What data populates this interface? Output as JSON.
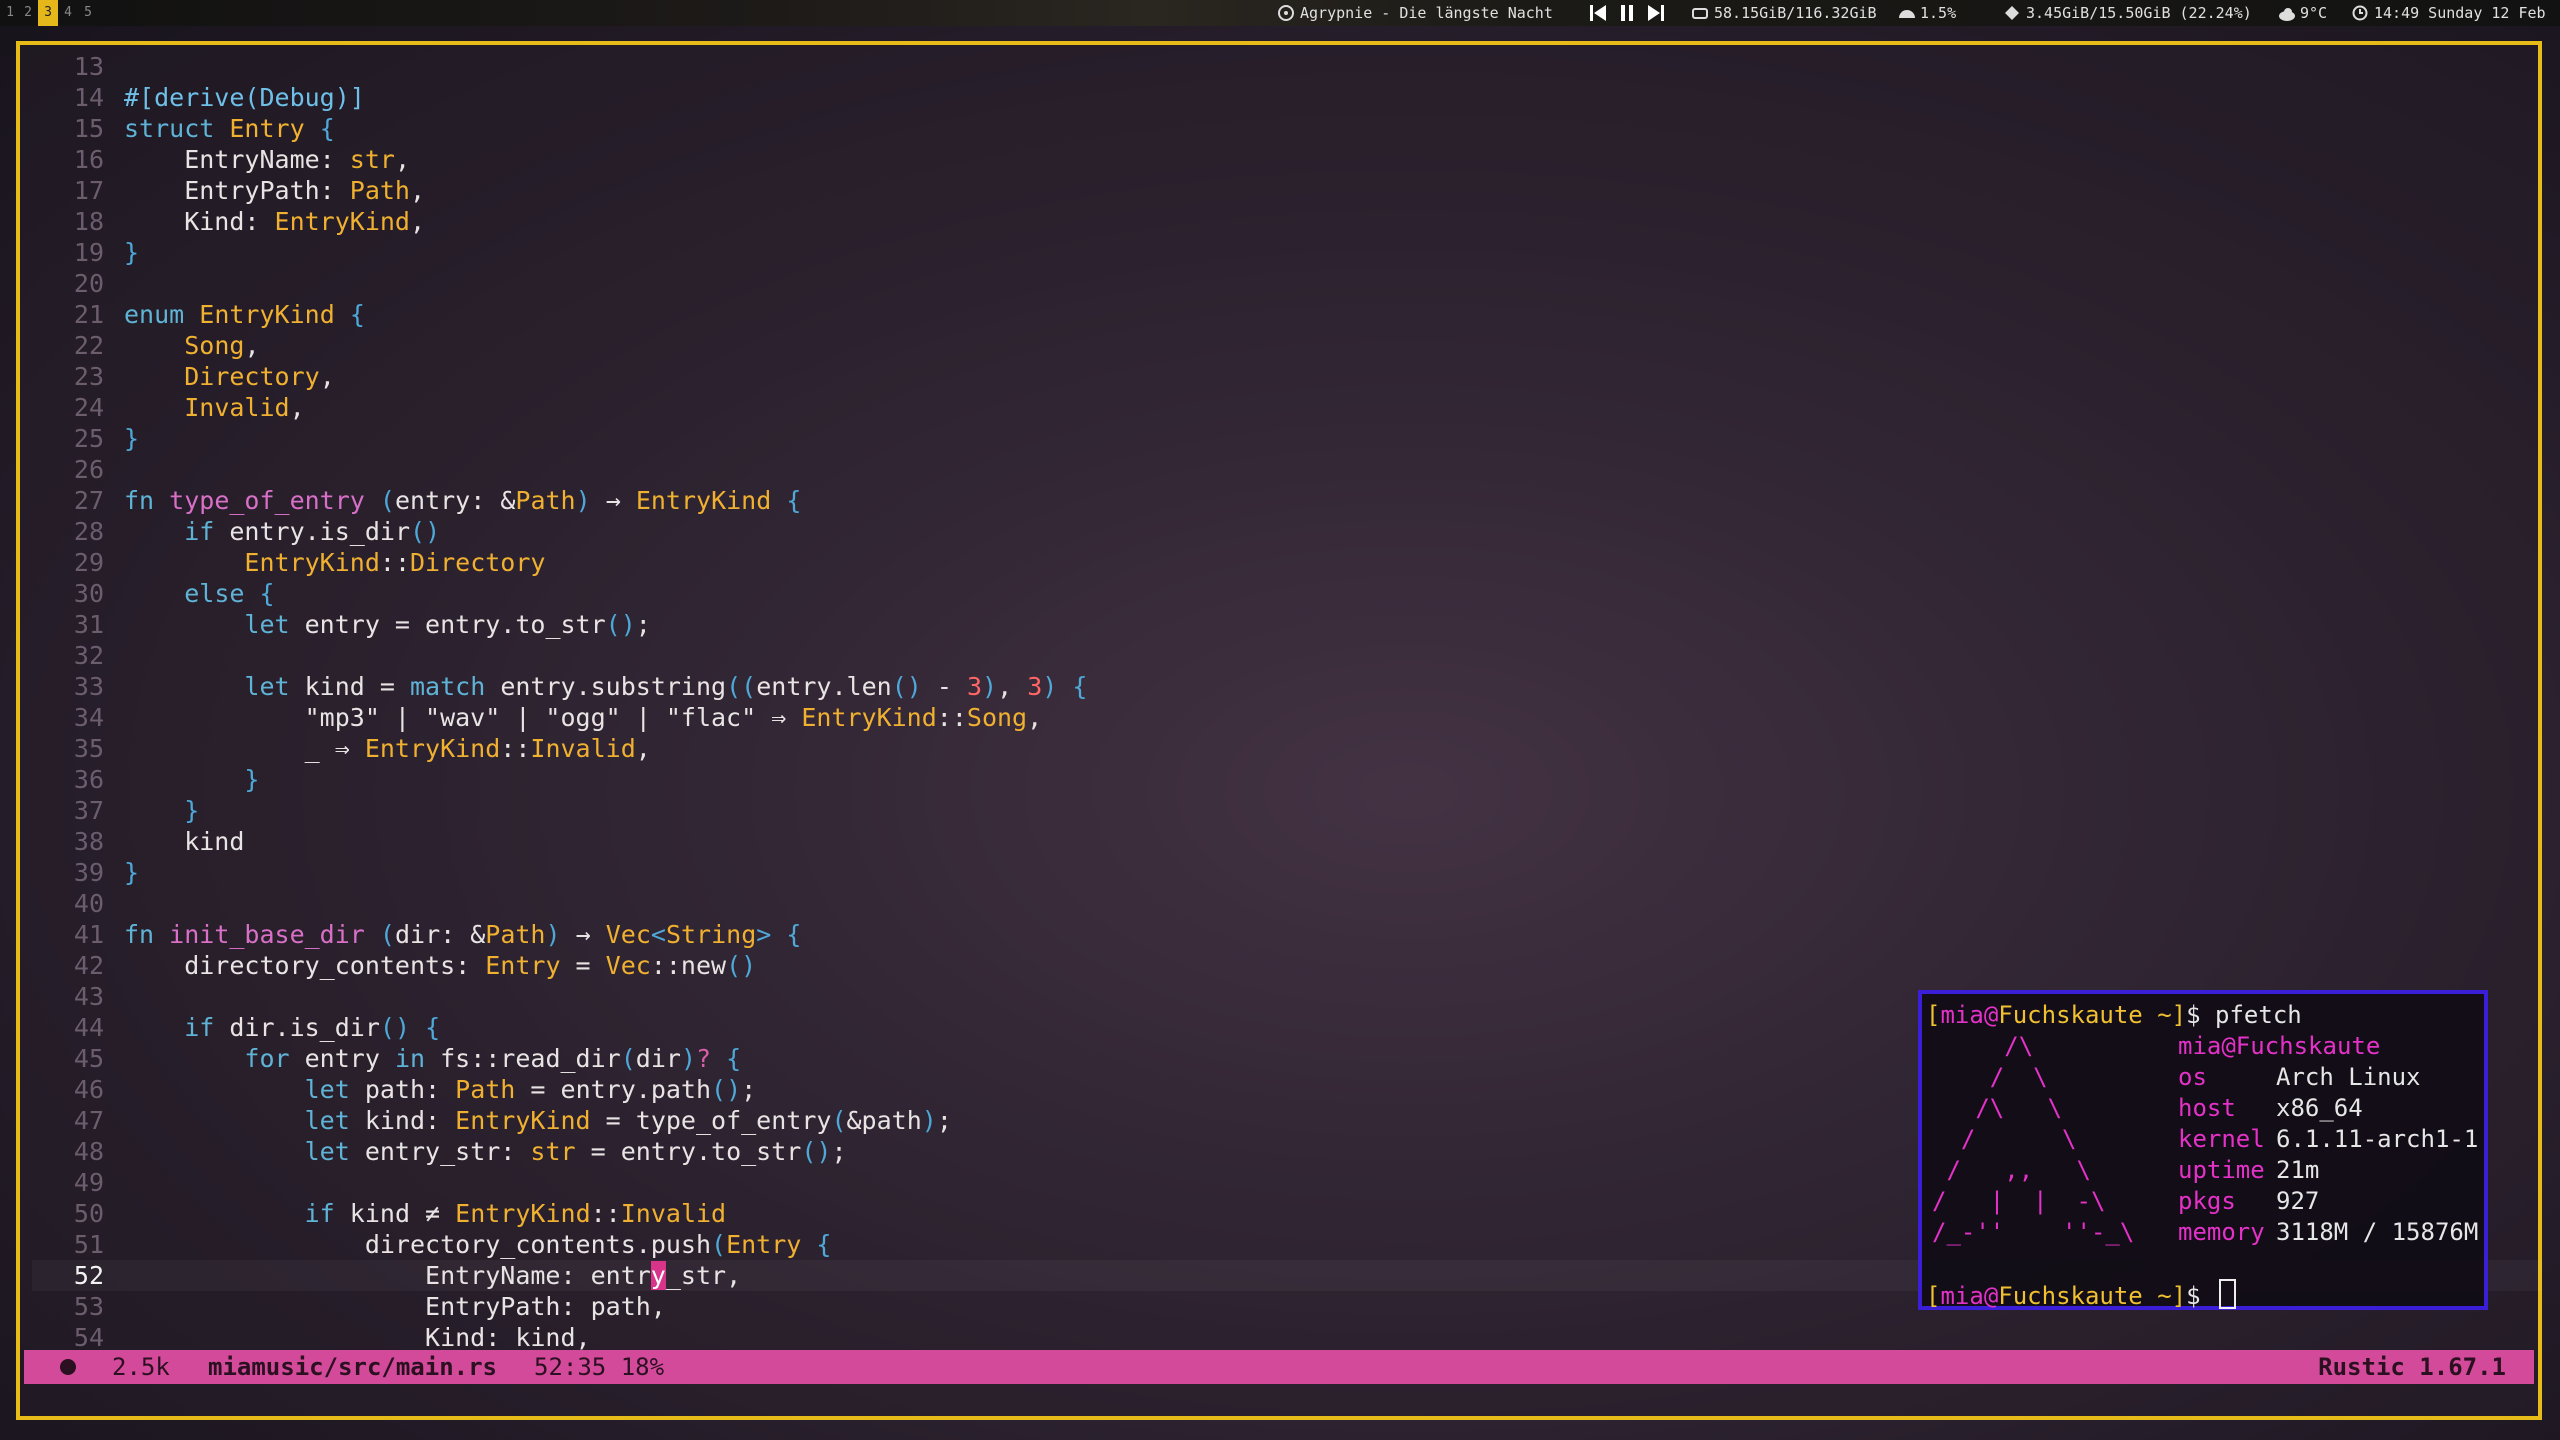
{
  "topbar": {
    "workspaces": [
      "1",
      "2",
      "3",
      "4",
      "5"
    ],
    "active_workspace": "3",
    "now_playing": "Agrypnie - Die längste Nacht",
    "disk": "58.15GiB/116.32GiB",
    "cpu": "1.5%",
    "memory": "3.45GiB/15.50GiB (22.24%)",
    "weather": "9°C",
    "clock": "14:49 Sunday 12 Feb"
  },
  "editor": {
    "lines": [
      {
        "n": "13",
        "t": ""
      },
      {
        "n": "14",
        "t": "#[derive(Debug)]"
      },
      {
        "n": "15",
        "t": "struct Entry {"
      },
      {
        "n": "16",
        "t": "    EntryName: str,"
      },
      {
        "n": "17",
        "t": "    EntryPath: Path,"
      },
      {
        "n": "18",
        "t": "    Kind: EntryKind,"
      },
      {
        "n": "19",
        "t": "}"
      },
      {
        "n": "20",
        "t": ""
      },
      {
        "n": "21",
        "t": "enum EntryKind {"
      },
      {
        "n": "22",
        "t": "    Song,"
      },
      {
        "n": "23",
        "t": "    Directory,"
      },
      {
        "n": "24",
        "t": "    Invalid,"
      },
      {
        "n": "25",
        "t": "}"
      },
      {
        "n": "26",
        "t": ""
      },
      {
        "n": "27",
        "t": "fn type_of_entry (entry: &Path) → EntryKind {"
      },
      {
        "n": "28",
        "t": "    if entry.is_dir()"
      },
      {
        "n": "29",
        "t": "        EntryKind::Directory"
      },
      {
        "n": "30",
        "t": "    else {"
      },
      {
        "n": "31",
        "t": "        let entry = entry.to_str();"
      },
      {
        "n": "32",
        "t": ""
      },
      {
        "n": "33",
        "t": "        let kind = match entry.substring((entry.len() - 3), 3) {"
      },
      {
        "n": "34",
        "t": "            \"mp3\" | \"wav\" | \"ogg\" | \"flac\" ⇒ EntryKind::Song,"
      },
      {
        "n": "35",
        "t": "            _ ⇒ EntryKind::Invalid,"
      },
      {
        "n": "36",
        "t": "        }"
      },
      {
        "n": "37",
        "t": "    }"
      },
      {
        "n": "38",
        "t": "    kind"
      },
      {
        "n": "39",
        "t": "}"
      },
      {
        "n": "40",
        "t": ""
      },
      {
        "n": "41",
        "t": "fn init_base_dir (dir: &Path) → Vec<String> {"
      },
      {
        "n": "42",
        "t": "    directory_contents: Entry = Vec::new()"
      },
      {
        "n": "43",
        "t": ""
      },
      {
        "n": "44",
        "t": "    if dir.is_dir() {"
      },
      {
        "n": "45",
        "t": "        for entry in fs::read_dir(dir)? {"
      },
      {
        "n": "46",
        "t": "            let path: Path = entry.path();"
      },
      {
        "n": "47",
        "t": "            let kind: EntryKind = type_of_entry(&path);"
      },
      {
        "n": "48",
        "t": "            let entry_str: str = entry.to_str();"
      },
      {
        "n": "49",
        "t": ""
      },
      {
        "n": "50",
        "t": "            if kind ≠ EntryKind::Invalid"
      },
      {
        "n": "51",
        "t": "                directory_contents.push(Entry {"
      },
      {
        "n": "52",
        "t": "                    EntryName: entry_str,"
      },
      {
        "n": "53",
        "t": "                    EntryPath: path,"
      },
      {
        "n": "54",
        "t": "                    Kind: kind,"
      }
    ],
    "current_line": "52"
  },
  "status": {
    "size": "2.5k",
    "file": "miamusic/src/main.rs",
    "position": "52:35",
    "percent": "18%",
    "language": "Rustic 1.67.1"
  },
  "terminal": {
    "prompt_user": "mia",
    "prompt_host": "Fuchskaute",
    "prompt_dir": "~",
    "command": "pfetch",
    "title": "mia@Fuchskaute",
    "art": [
      "     /\\",
      "    /  \\",
      "   /\\   \\",
      "  /      \\",
      " /   ,,   \\",
      "/   |  |  -\\",
      "/_-''    ''-_\\"
    ],
    "info": [
      {
        "key": "os",
        "value": "Arch Linux"
      },
      {
        "key": "host",
        "value": "x86_64"
      },
      {
        "key": "kernel",
        "value": "6.1.11-arch1-1"
      },
      {
        "key": "uptime",
        "value": "21m"
      },
      {
        "key": "pkgs",
        "value": "927"
      },
      {
        "key": "memory",
        "value": "3118M / 15876M"
      }
    ]
  }
}
